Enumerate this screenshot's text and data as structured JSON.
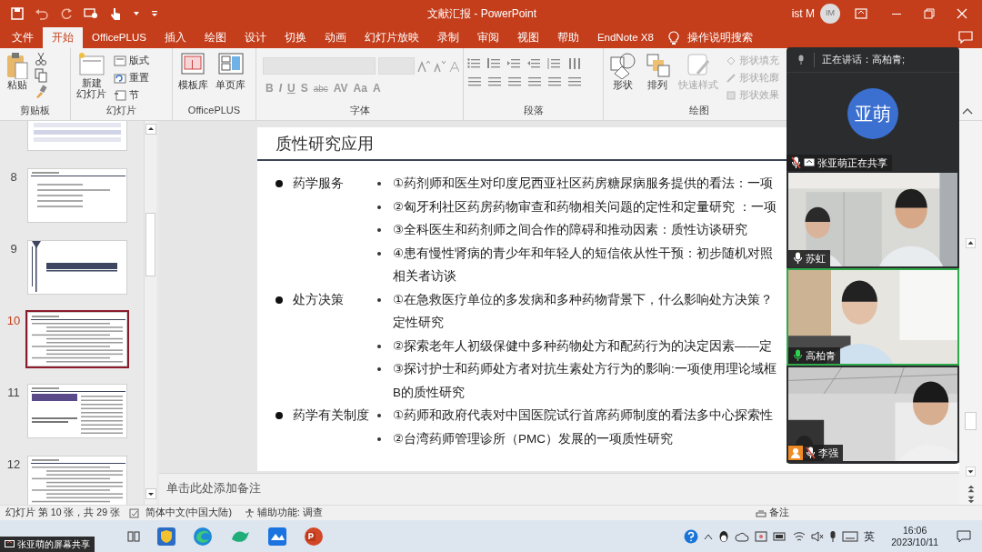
{
  "window": {
    "title": "文献汇报 - PowerPoint",
    "user": "ist M",
    "avatar_initials": "IM"
  },
  "ribbon_tabs": [
    {
      "label": "文件",
      "selected": false
    },
    {
      "label": "开始",
      "selected": true
    },
    {
      "label": "OfficePLUS",
      "selected": false
    },
    {
      "label": "插入",
      "selected": false
    },
    {
      "label": "绘图",
      "selected": false
    },
    {
      "label": "设计",
      "selected": false
    },
    {
      "label": "切换",
      "selected": false
    },
    {
      "label": "动画",
      "selected": false
    },
    {
      "label": "幻灯片放映",
      "selected": false
    },
    {
      "label": "录制",
      "selected": false
    },
    {
      "label": "审阅",
      "selected": false
    },
    {
      "label": "视图",
      "selected": false
    },
    {
      "label": "帮助",
      "selected": false
    },
    {
      "label": "EndNote X8",
      "selected": false
    }
  ],
  "tell_me": "操作说明搜索",
  "ribbon_groups": [
    {
      "kind": "clipboard",
      "label": "剪贴板",
      "buttons": [
        "粘贴"
      ]
    },
    {
      "kind": "slides",
      "label": "幻灯片",
      "new_slide_lines": [
        "新建",
        "幻灯片"
      ],
      "buttons": [
        "版式",
        "重置",
        "节"
      ]
    },
    {
      "kind": "officeplus",
      "label": "OfficePLUS",
      "buttons": [
        "模板库",
        "单页库"
      ]
    },
    {
      "kind": "font",
      "label": "字体",
      "buttons": [
        "B",
        "I",
        "U",
        "S",
        "abc",
        "AV",
        "Aa",
        "A"
      ]
    },
    {
      "kind": "paragraph",
      "label": "段落"
    },
    {
      "kind": "drawing",
      "label": "绘图",
      "buttons": [
        "形状",
        "排列",
        "快速样式",
        "形状填充",
        "形状轮廓",
        "形状效果"
      ]
    }
  ],
  "slides_pane": {
    "items": [
      {
        "selected": false
      },
      {
        "number": "8",
        "selected": false
      },
      {
        "number": "9",
        "selected": false
      },
      {
        "number": "10",
        "selected": true
      },
      {
        "number": "11",
        "selected": false
      },
      {
        "number": "12",
        "selected": false
      }
    ]
  },
  "slide": {
    "title": "质性研究应用",
    "sections": [
      {
        "heading": "药学服务",
        "items": [
          [
            "①药剂师和医生对印度尼西亚社区药房糖尿病服务提供的看法：一项"
          ],
          [
            "②匈牙利社区药房药物审查和药物相关问题的定性和定量研究 ：一项"
          ],
          [
            "③全科医生和药剂师之间合作的障碍和推动因素：质性访谈研究"
          ],
          [
            "④患有慢性肾病的青少年和年轻人的短信依从性干预：初步随机对照",
            "相关者访谈"
          ]
        ]
      },
      {
        "heading": "处方决策",
        "items": [
          [
            "①在急救医疗单位的多发病和多种药物背景下，什么影响处方决策？",
            "定性研究"
          ],
          [
            "②探索老年人初级保健中多种药物处方和配药行为的决定因素——定"
          ],
          [
            "③探讨护士和药师处方者对抗生素处方行为的影响:一项使用理论域框",
            "B的质性研究"
          ]
        ]
      },
      {
        "heading": "药学有关制度",
        "items": [
          [
            "①药师和政府代表对中国医院试行首席药师制度的看法多中心探索性"
          ],
          [
            "②台湾药师管理诊所（PMC）发展的一项质性研究"
          ]
        ]
      }
    ]
  },
  "notes_placeholder": "单击此处添加备注",
  "status_bar": {
    "slide_position": "幻灯片 第 10 张，共 29 张",
    "language": "简体中文(中国大陆)",
    "accessibility": "辅助功能: 调查",
    "notes": "备注"
  },
  "meeting": {
    "speaking": "正在讲话：高柏青;",
    "presenter": {
      "avatar": "亚萌",
      "label": "张亚萌正在共享"
    },
    "participants": [
      {
        "name": "苏虹",
        "muted": false,
        "speaking": false,
        "selected": false,
        "host": false
      },
      {
        "name": "高柏青",
        "muted": false,
        "speaking": true,
        "selected": true,
        "host": false
      },
      {
        "name": "李强",
        "muted": true,
        "speaking": false,
        "selected": false,
        "host": true
      }
    ]
  },
  "screen_share_badge": "张亚萌的屏幕共享",
  "taskbar": {
    "input_method": "英",
    "time": "16:06",
    "date": "2023/10/11"
  }
}
